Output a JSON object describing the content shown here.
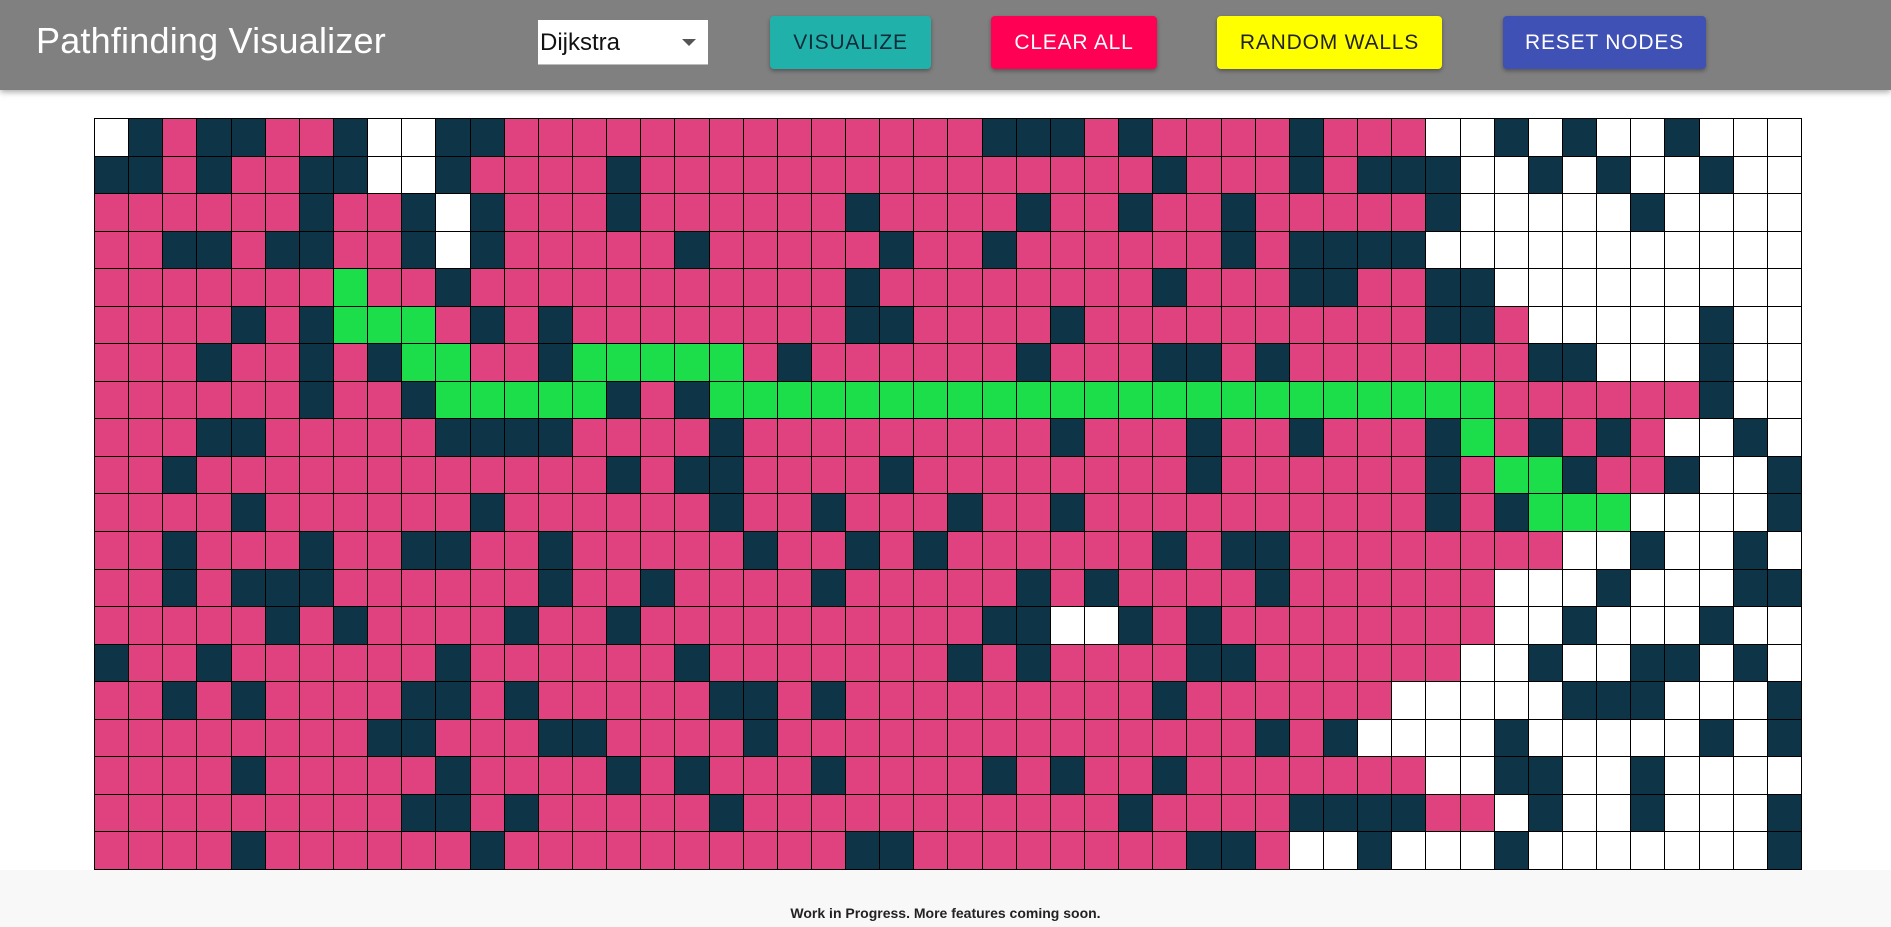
{
  "app": {
    "title": "Pathfinding Visualizer"
  },
  "toolbar": {
    "algorithm_selected": "Dijkstra",
    "visualize_label": "VISUALIZE",
    "clear_label": "CLEAR ALL",
    "random_walls_label": "RANDOM WALLS",
    "reset_nodes_label": "RESET NODES"
  },
  "colors": {
    "appbar": "#808080",
    "visited": "#e0417f",
    "wall": "#0e3448",
    "path": "#1bde4a",
    "unvisited": "#ffffff",
    "visualize_button": "#20b2aa",
    "clear_button": "#ff0055",
    "random_walls_button": "#ffff00",
    "reset_button": "#3f51b5"
  },
  "grid": {
    "rows": 20,
    "cols": 50,
    "legend": {
      ".": "unvisited",
      "v": "visited",
      "w": "wall",
      "p": "path"
    },
    "cells": [
      ".wvwwvvw..wwvvvvvvvvvvvvvvwwwvwvvvvwvvv..w.w..w...w.",
      "wwvwvvwwe.wvvvvwvvvvvvvvvvvvvvvwvvvwvwww..w.w..w...",
      "vvvvvvwvvw.wvvvwvvvvvvwvvvvwvvwvvwvvvvvw.....w....w",
      "vvwwvwwvvw.wvvvvvwvvvvvwvvwvvvvvvwvwwww..........",
      "vvvvvvvpvvwvvvvvvvvvvvwvvvvvvvvwvvvwwvvww.........",
      "vvvvwvwpppvwvwvvvvvvvvwwvvvvwvvvvvvvvvvwwv.....w..",
      "vvvwvvwvwppvvwpppppvwvvvvvvwvvvwwvwvvvvvvvww...w..",
      "vvvvvvwvvwpppppwvwpppppppppppppppppppppppvvvvvvw..w..",
      "vvvwwvvvvvwwwwvvvvwvvvvvvvvvwvvvwvvwvvvwpvwvwv..w.w.ww",
      "vvwvvvvvvvvvvvvwvwwvvvvwvvvvvvvvwvvvvvvwvppwvvw..w.w.w",
      "vvvvwvvvvvvwvvvvvvwvvwvvvwvvwvvvvvvvvvvwvwppp....ww.w..",
      "vvwvvvwvvwwvvwvvvvvwvvwvwvvvvvvwvwwvvvvvvvv..w..w...w",
      "vvwvwwwvvvvvvwvvwvvvvwvvvvvwvwvvvvwvvvvvv...w...ww...",
      "vvvvvwvwvvvvwvvwvvvvvvvvvvwwe.wvwvvvvvvvv..w...w..w..",
      "wvvwvvvvvvwvvvvvvwvvvvvvvwvwvvvvwwvvvvvv..w..ww.w.w..",
      "vvwvwvvvvwwvwvvvvvwwvwvvvvvvvvvwvvvvvv.....www...w.ww",
      "vvvvvvvvwwvvvwwvvvvwvvvvvvvvvvvvvvwvw....w.....w.w...",
      "vvvvwvvvvvwvvvvwvwvvvwvvvvwvwvvwvvvvvvv..ww..w........w",
      "vvvvvvvvvwwvwvvvvvwvvvvvvvvvvvwvvvvwwwwvv.w..w...w..w.w",
      "vvvvwvvvvvvwvvvvvvvvvvwwvvvvvvvvwwv..w...w.......w..."
    ]
  },
  "footer": {
    "text": "Work in Progress. More features coming soon."
  }
}
